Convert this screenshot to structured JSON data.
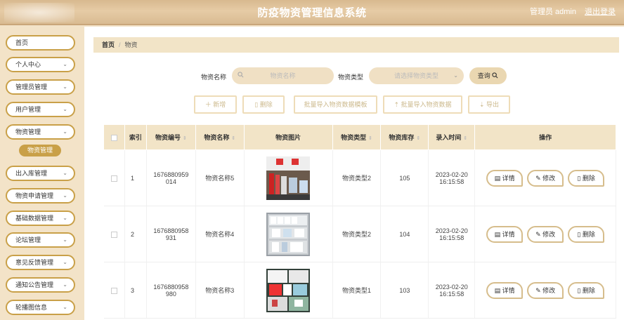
{
  "header": {
    "title": "防疫物资管理信息系统",
    "user": "管理员 admin",
    "logout": "退出登录"
  },
  "sidebar": {
    "items": [
      {
        "label": "首页",
        "chevron": false
      },
      {
        "label": "个人中心",
        "chevron": true
      },
      {
        "label": "管理员管理",
        "chevron": true
      },
      {
        "label": "用户管理",
        "chevron": true
      },
      {
        "label": "物资管理",
        "chevron": true
      },
      {
        "label": "出入库管理",
        "chevron": true
      },
      {
        "label": "物资申请管理",
        "chevron": true
      },
      {
        "label": "基础数据管理",
        "chevron": true
      },
      {
        "label": "论坛管理",
        "chevron": true
      },
      {
        "label": "意见反馈管理",
        "chevron": true
      },
      {
        "label": "通知公告管理",
        "chevron": true
      },
      {
        "label": "轮播图信息",
        "chevron": true
      }
    ],
    "active_sub": "物资管理",
    "chevron_glyph": "⌄"
  },
  "breadcrumb": {
    "home": "首页",
    "sep": "/",
    "current": "物资"
  },
  "search": {
    "name_label": "物资名称",
    "name_placeholder": "物资名称",
    "type_label": "物资类型",
    "type_placeholder": "请选择物资类型",
    "query_button": "查询"
  },
  "toolbar": {
    "add": "新增",
    "delete": "删除",
    "import_template": "批量导入物资数据模板",
    "import_data": "批量导入物资数据",
    "export": "导出"
  },
  "table": {
    "headers": {
      "index": "索引",
      "code": "物资编号",
      "name": "物资名称",
      "image": "物资图片",
      "type": "物资类型",
      "stock": "物资库存",
      "time": "录入时间",
      "ops": "操作"
    },
    "rows": [
      {
        "index": "1",
        "code_line1": "1676880959",
        "code_line2": "014",
        "name": "物资名称5",
        "type": "物资类型2",
        "stock": "105",
        "date": "2023-02-20",
        "time": "16:15:58"
      },
      {
        "index": "2",
        "code_line1": "1676880958",
        "code_line2": "931",
        "name": "物资名称4",
        "type": "物资类型2",
        "stock": "104",
        "date": "2023-02-20",
        "time": "16:15:58"
      },
      {
        "index": "3",
        "code_line1": "1676880958",
        "code_line2": "980",
        "name": "物资名称3",
        "type": "物资类型1",
        "stock": "103",
        "date": "2023-02-20",
        "time": "16:15:58"
      }
    ],
    "actions": {
      "detail": "详情",
      "edit": "修改",
      "delete": "删除"
    }
  },
  "colors": {
    "accent": "#c9a048",
    "header_bg": "#d9bb92",
    "table_head_bg": "#f2e4c7"
  }
}
